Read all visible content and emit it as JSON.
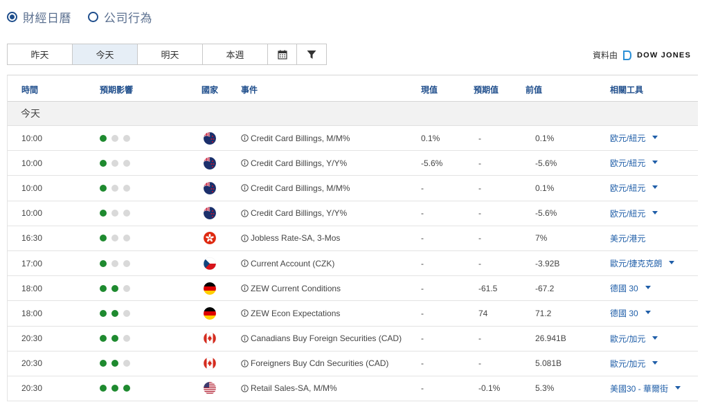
{
  "radio": {
    "options": [
      {
        "label": "財經日曆",
        "selected": true
      },
      {
        "label": "公司行為",
        "selected": false
      }
    ]
  },
  "day_tabs": [
    {
      "label": "昨天",
      "active": false
    },
    {
      "label": "今天",
      "active": true
    },
    {
      "label": "明天",
      "active": false
    },
    {
      "label": "本週",
      "active": false
    }
  ],
  "tool_icons": [
    "calendar-icon",
    "filter-icon"
  ],
  "source": {
    "label": "資料由",
    "brand": "DOW JONES"
  },
  "headers": {
    "time": "時間",
    "impact": "預期影響",
    "country": "國家",
    "event": "事件",
    "actual": "現值",
    "forecast": "預期值",
    "previous": "前值",
    "tools": "相關工具"
  },
  "section": {
    "label": "今天"
  },
  "rows": [
    {
      "time": "10:00",
      "impact": 1,
      "flag": "nz-flag-icon",
      "event": "Credit Card Billings, M/M%",
      "actual": "0.1%",
      "forecast": "-",
      "previous": "0.1%",
      "tool": "欧元/紐元",
      "has_caret": true
    },
    {
      "time": "10:00",
      "impact": 1,
      "flag": "nz-flag-icon",
      "event": "Credit Card Billings, Y/Y%",
      "actual": "-5.6%",
      "forecast": "-",
      "previous": "-5.6%",
      "tool": "欧元/紐元",
      "has_caret": true
    },
    {
      "time": "10:00",
      "impact": 1,
      "flag": "nz-flag-icon",
      "event": "Credit Card Billings, M/M%",
      "actual": "-",
      "forecast": "-",
      "previous": "0.1%",
      "tool": "欧元/紐元",
      "has_caret": true
    },
    {
      "time": "10:00",
      "impact": 1,
      "flag": "nz-flag-icon",
      "event": "Credit Card Billings, Y/Y%",
      "actual": "-",
      "forecast": "-",
      "previous": "-5.6%",
      "tool": "欧元/紐元",
      "has_caret": true
    },
    {
      "time": "16:30",
      "impact": 1,
      "flag": "hk-flag-icon",
      "event": "Jobless Rate-SA, 3-Mos",
      "actual": "-",
      "forecast": "-",
      "previous": "7%",
      "tool": "美元/港元",
      "has_caret": false
    },
    {
      "time": "17:00",
      "impact": 1,
      "flag": "cz-flag-icon",
      "event": "Current Account (CZK)",
      "actual": "-",
      "forecast": "-",
      "previous": "-3.92B",
      "tool": "歐元/捷克克朗",
      "has_caret": true
    },
    {
      "time": "18:00",
      "impact": 2,
      "flag": "de-flag-icon",
      "event": "ZEW Current Conditions",
      "actual": "-",
      "forecast": "-61.5",
      "previous": "-67.2",
      "tool": "德國 30",
      "has_caret": true
    },
    {
      "time": "18:00",
      "impact": 2,
      "flag": "de-flag-icon",
      "event": "ZEW Econ Expectations",
      "actual": "-",
      "forecast": "74",
      "previous": "71.2",
      "tool": "德國 30",
      "has_caret": true
    },
    {
      "time": "20:30",
      "impact": 2,
      "flag": "ca-flag-icon",
      "event": "Canadians Buy Foreign Securities (CAD)",
      "actual": "-",
      "forecast": "-",
      "previous": "26.941B",
      "tool": "歐元/加元",
      "has_caret": true
    },
    {
      "time": "20:30",
      "impact": 2,
      "flag": "ca-flag-icon",
      "event": "Foreigners Buy Cdn Securities (CAD)",
      "actual": "-",
      "forecast": "-",
      "previous": "5.081B",
      "tool": "歐元/加元",
      "has_caret": true
    },
    {
      "time": "20:30",
      "impact": 3,
      "flag": "us-flag-icon",
      "event": "Retail Sales-SA, M/M%",
      "actual": "-",
      "forecast": "-0.1%",
      "previous": "5.3%",
      "tool": "美國30 - 華爾街",
      "has_caret": true
    }
  ],
  "colors": {
    "accent": "#1f4e8c",
    "impact_on": "#1e8a2f",
    "impact_off": "#d9d9d9",
    "link": "#1f5ea8",
    "active_tab": "#e6eef6"
  }
}
